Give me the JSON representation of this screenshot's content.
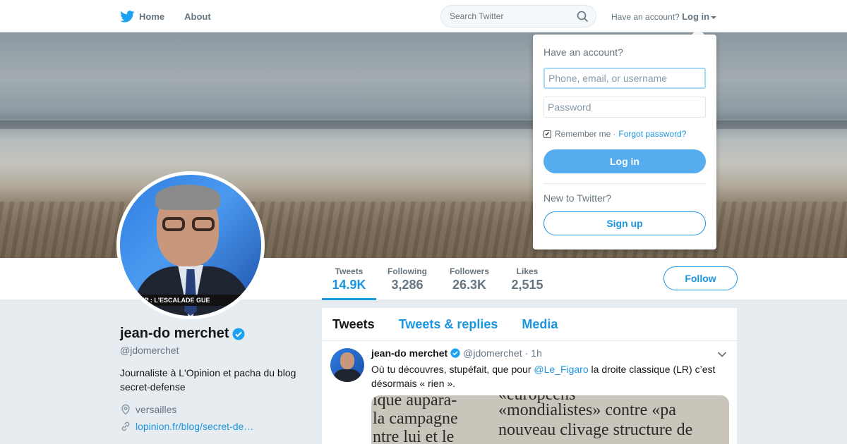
{
  "topbar": {
    "home": "Home",
    "about": "About",
    "search_placeholder": "Search Twitter",
    "have_account": "Have an account?",
    "login": "Log in"
  },
  "dropdown": {
    "heading": "Have an account?",
    "username_placeholder": "Phone, email, or username",
    "password_placeholder": "Password",
    "remember": "Remember me",
    "separator": "·",
    "forgot": "Forgot password?",
    "login_button": "Log in",
    "new_to": "New to Twitter?",
    "signup_button": "Sign up"
  },
  "stats": [
    {
      "label": "Tweets",
      "value": "14.9K"
    },
    {
      "label": "Following",
      "value": "3,286"
    },
    {
      "label": "Followers",
      "value": "26.3K"
    },
    {
      "label": "Likes",
      "value": "2,515"
    }
  ],
  "follow_button": "Follow",
  "avatar_caption": "RUMP : L'ESCALADE GUE",
  "profile": {
    "name": "jean-do merchet",
    "handle": "@jdomerchet",
    "bio": "Journaliste à L'Opinion et pacha du blog secret-defense",
    "location": "versailles",
    "link": "lopinion.fr/blog/secret-de…"
  },
  "tabs": [
    "Tweets",
    "Tweets & replies",
    "Media"
  ],
  "tweet": {
    "name": "jean-do merchet",
    "handle": "@jdomerchet",
    "dot": "·",
    "time": "1h",
    "text_before": "Où tu découvres, stupéfait, que pour ",
    "mention": "@Le_Figaro",
    "text_after": " la droite classique (LR) c’est désormais « rien ».",
    "media_lines": [
      "ique aupara-",
      "«européens",
      "la campagne",
      "«mondialistes» contre «pa",
      "ntre lui et le",
      "nouveau clivage structure de"
    ]
  },
  "colors": {
    "accent": "#1b95e0",
    "button_blue": "#55acee",
    "muted": "#657786"
  }
}
